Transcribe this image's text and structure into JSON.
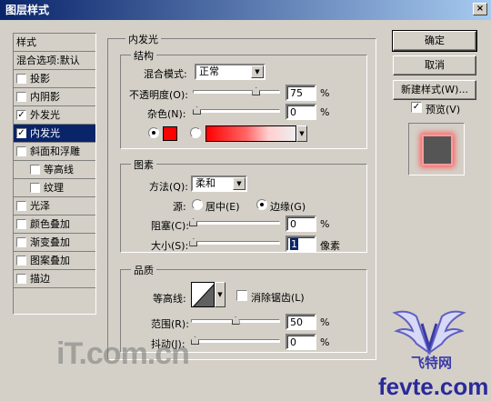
{
  "window": {
    "title": "图层样式",
    "close_glyph": "×"
  },
  "style_list": {
    "header": "样式",
    "items": [
      {
        "label": "混合选项:默认",
        "checkbox": false,
        "checked": false,
        "indent": false,
        "selected": false
      },
      {
        "label": "投影",
        "checkbox": true,
        "checked": false,
        "indent": false,
        "selected": false
      },
      {
        "label": "内阴影",
        "checkbox": true,
        "checked": false,
        "indent": false,
        "selected": false
      },
      {
        "label": "外发光",
        "checkbox": true,
        "checked": true,
        "indent": false,
        "selected": false
      },
      {
        "label": "内发光",
        "checkbox": true,
        "checked": true,
        "indent": false,
        "selected": true
      },
      {
        "label": "斜面和浮雕",
        "checkbox": true,
        "checked": false,
        "indent": false,
        "selected": false
      },
      {
        "label": "等高线",
        "checkbox": true,
        "checked": false,
        "indent": true,
        "selected": false
      },
      {
        "label": "纹理",
        "checkbox": true,
        "checked": false,
        "indent": true,
        "selected": false
      },
      {
        "label": "光泽",
        "checkbox": true,
        "checked": false,
        "indent": false,
        "selected": false
      },
      {
        "label": "颜色叠加",
        "checkbox": true,
        "checked": false,
        "indent": false,
        "selected": false
      },
      {
        "label": "渐变叠加",
        "checkbox": true,
        "checked": false,
        "indent": false,
        "selected": false
      },
      {
        "label": "图案叠加",
        "checkbox": true,
        "checked": false,
        "indent": false,
        "selected": false
      },
      {
        "label": "描边",
        "checkbox": true,
        "checked": false,
        "indent": false,
        "selected": false
      }
    ]
  },
  "panel": {
    "title": "内发光",
    "structure": {
      "title": "结构",
      "blend_mode_label": "混合模式:",
      "blend_mode_value": "正常",
      "opacity_label": "不透明度(O):",
      "opacity_value": "75",
      "opacity_unit": "%",
      "opacity_level": 0.75,
      "noise_label": "杂色(N):",
      "noise_value": "0",
      "noise_unit": "%",
      "noise_level": 0,
      "glow_color": "#ff0000"
    },
    "elements": {
      "title": "图素",
      "method_label": "方法(Q):",
      "method_value": "柔和",
      "source_label": "源:",
      "source_center": "居中(E)",
      "source_edge": "边缘(G)",
      "choke_label": "阻塞(C):",
      "choke_value": "0",
      "choke_unit": "%",
      "choke_level": 0,
      "size_label": "大小(S):",
      "size_value": "1",
      "size_unit": "像素",
      "size_level": 0.004
    },
    "quality": {
      "title": "品质",
      "contour_label": "等高线:",
      "antialias_label": "消除锯齿(L)",
      "range_label": "范围(R):",
      "range_value": "50",
      "range_unit": "%",
      "range_level": 0.5,
      "jitter_label": "抖动(J):",
      "jitter_value": "0",
      "jitter_unit": "%",
      "jitter_level": 0
    }
  },
  "buttons": {
    "ok": "确定",
    "cancel": "取消",
    "new_style": "新建样式(W)...",
    "preview_label": "预览(V)"
  },
  "watermarks": {
    "left": "iT.com.cn",
    "right_cn": "飞特网",
    "right": "fevte.com"
  }
}
